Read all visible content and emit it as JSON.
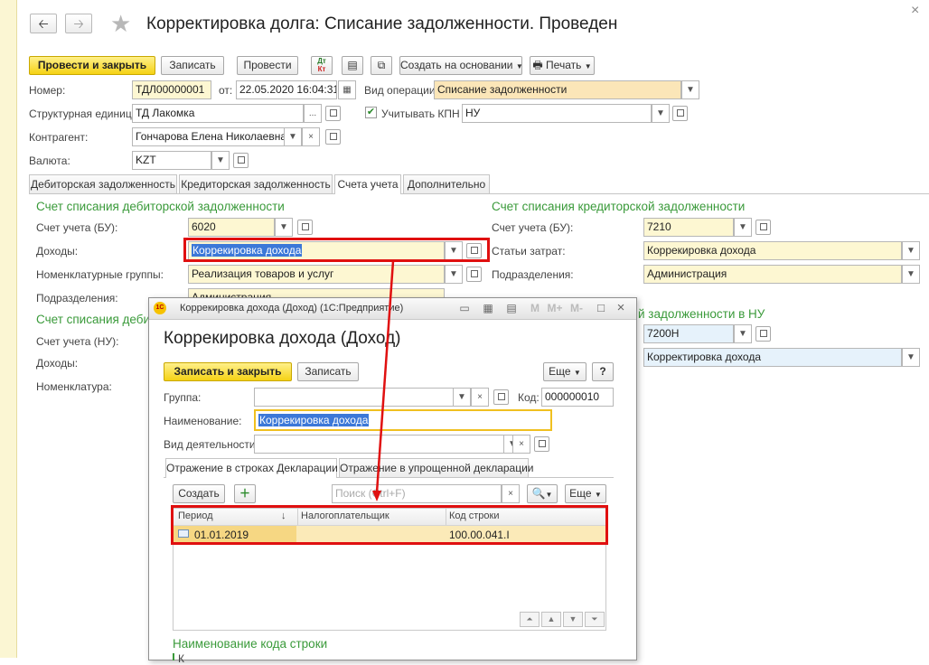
{
  "header": {
    "back_icon": "arrow-left-icon",
    "forward_icon": "arrow-right-icon",
    "favorite_icon": "star-icon",
    "title": "Корректировка долга: Списание задолженности. Проведен"
  },
  "toolbar": {
    "post_close": "Провести и закрыть",
    "save": "Записать",
    "post": "Провести",
    "dt_kt_top": "Дт",
    "dt_kt_bottom": "Кт",
    "create_based": "Создать на основании",
    "print": "Печать"
  },
  "form": {
    "number_label": "Номер:",
    "number_value": "ТДЛ00000001",
    "date_label": "от:",
    "date_value": "22.05.2020 16:04:31",
    "operation_label": "Вид операции:",
    "operation_value": "Списание задолженности",
    "unit_label": "Структурная единица:",
    "unit_value": "ТД Лакомка",
    "kpn_label": "Учитывать КПН",
    "kpn_value": "НУ",
    "counterparty_label": "Контрагент:",
    "counterparty_value": "Гончарова Елена Николаевна",
    "currency_label": "Валюта:",
    "currency_value": "KZT"
  },
  "tabs": [
    "Дебиторская задолженность",
    "Кредиторская задолженность",
    "Счета учета",
    "Дополнительно"
  ],
  "left_section": {
    "title": "Счет списания дебиторской задолженности",
    "account_bu_label": "Счет учета (БУ):",
    "account_bu_value": "6020",
    "income_label": "Доходы:",
    "income_value": "Коррекировка дохода",
    "nomgroups_label": "Номенклатурные группы:",
    "nomgroups_value": "Реализация товаров и услуг",
    "divisions_label": "Подразделения:",
    "divisions_value": "Администрация",
    "title2": "Счет списания деби",
    "account_nu_label": "Счет учета (НУ):",
    "income2_label": "Доходы:",
    "nomenclature_label": "Номенклатура:"
  },
  "right_section": {
    "title": "Счет списания кредиторской задолженности",
    "account_bu_label": "Счет учета (БУ):",
    "account_bu_value": "7210",
    "expense_label": "Статьи затрат:",
    "expense_value": "Коррекировка дохода",
    "divisions_label": "Подразделения:",
    "divisions_value": "Администрация",
    "title2": "й задолженности в НУ",
    "account_nu_value": "7200Н",
    "expense_nu_value": "Корректировка дохода"
  },
  "dialog": {
    "window_title": "Коррекировка дохода (Доход)  (1С:Предприятие)",
    "m_label": "M",
    "mplus_label": "M+",
    "mminus_label": "M-",
    "heading": "Коррекировка дохода (Доход)",
    "save_close": "Записать и закрыть",
    "save": "Записать",
    "more": "Еще",
    "help": "?",
    "group_label": "Группа:",
    "code_label": "Код:",
    "code_value": "000000010",
    "name_label": "Наименование:",
    "name_value": "Коррекировка дохода",
    "activity_label": "Вид деятельности:",
    "tabs": [
      "Отражение в строках Декларации",
      "Отражение в упрощенной декларации"
    ],
    "create": "Создать",
    "search_placeholder": "Поиск (Ctrl+F)",
    "more2": "Еще",
    "columns": [
      "Период",
      "Налогоплательщик",
      "Код строки"
    ],
    "sort_indicator": "↓",
    "rows": [
      {
        "period": "01.01.2019",
        "taxpayer": "",
        "line_code": "100.00.041.I"
      }
    ],
    "line_name_title": "Наименование кода строки",
    "line_name_value": "К"
  },
  "colors": {
    "highlight_border": "#e01010",
    "accent_green": "#3a9a3a",
    "selection": "#3c78d8",
    "primary_button": "#f5d214"
  }
}
